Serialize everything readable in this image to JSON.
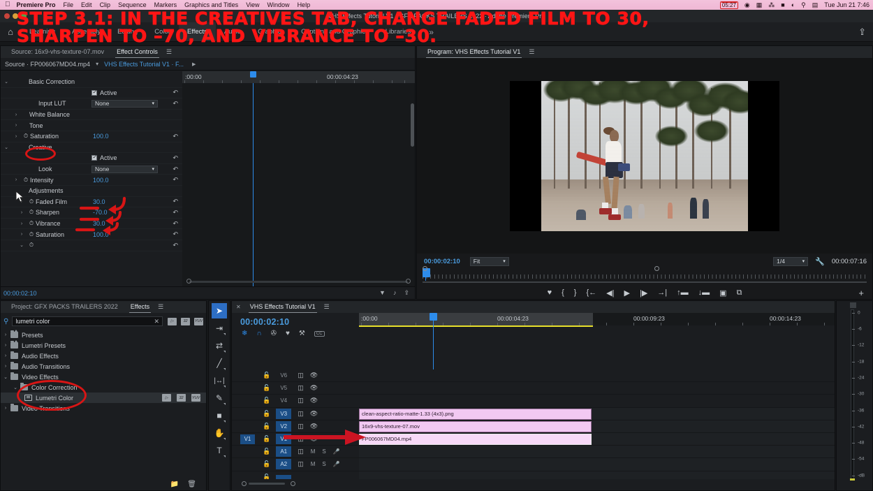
{
  "macmenu": {
    "apple": "",
    "items": [
      "Premiere Pro",
      "File",
      "Edit",
      "Clip",
      "Sequence",
      "Markers",
      "Graphics and Titles",
      "View",
      "Window",
      "Help"
    ],
    "status": {
      "record_time": "05:27",
      "clock": "Tue Jun 21  7:46"
    }
  },
  "titlebar": {
    "title": "VHS Effects Tutorial V1 · GFX PACKS TRAILERS 2022 · Adobe Premiere Pro"
  },
  "workspace": {
    "home_icon": "home-icon",
    "tabs": [
      "Learning",
      "Assembly",
      "Editing",
      "Color",
      "Effects",
      "Audio",
      "Graphics",
      "Captions and Graphics",
      "Libraries"
    ],
    "selected_tab": "Effects",
    "more": "»",
    "export_icon": "export-icon"
  },
  "annotation": {
    "line1": "STEP 3.1: IN THE CREATIVES TAB, CHANGE FADED FILM TO 30,",
    "line2": "SHARPEN TO –70, AND VIBRANCE TO –30.",
    "color": "#ff1515"
  },
  "effect_controls": {
    "tabs": [
      {
        "label": "Source: 16x9-vhs-texture-07.mov",
        "selected": false
      },
      {
        "label": "Effect Controls",
        "selected": true
      }
    ],
    "clip_source": "Source · FP006067MD04.mp4",
    "sequence": "VHS Effects Tutorial V1 · F...",
    "ruler": {
      "left_tc": ":00:00",
      "mid_tc": "00:00:04:23"
    },
    "rows": [
      {
        "type": "group",
        "label": "Basic Correction",
        "indent": 1,
        "arrow": "⌄"
      },
      {
        "type": "check",
        "label": "Active",
        "indent": 2,
        "checked": true
      },
      {
        "type": "dropdown",
        "label": "Input LUT",
        "indent": 2,
        "value": "None"
      },
      {
        "type": "group",
        "label": "White Balance",
        "indent": 2,
        "arrow": "›"
      },
      {
        "type": "group",
        "label": "Tone",
        "indent": 2,
        "arrow": "›"
      },
      {
        "type": "value",
        "label": "Saturation",
        "indent": 2,
        "arrow": "›",
        "value": "100.0",
        "stopwatch": true
      },
      {
        "type": "group",
        "label": "Creative",
        "indent": 1,
        "arrow": "⌄"
      },
      {
        "type": "check",
        "label": "Active",
        "indent": 2,
        "checked": true
      },
      {
        "type": "dropdown",
        "label": "Look",
        "indent": 2,
        "value": "None"
      },
      {
        "type": "value",
        "label": "Intensity",
        "indent": 2,
        "arrow": "›",
        "value": "100.0",
        "stopwatch": true
      },
      {
        "type": "group",
        "label": "Adjustments",
        "indent": 2,
        "arrow": ""
      },
      {
        "type": "value",
        "label": "Faded Film",
        "indent": 3,
        "arrow": "›",
        "value": "30.0",
        "stopwatch": true
      },
      {
        "type": "value",
        "label": "Sharpen",
        "indent": 3,
        "arrow": "›",
        "value": "-70.0",
        "stopwatch": true
      },
      {
        "type": "value",
        "label": "Vibrance",
        "indent": 3,
        "arrow": "›",
        "value": "30.0",
        "stopwatch": true
      },
      {
        "type": "value",
        "label": "Saturation",
        "indent": 3,
        "arrow": "›",
        "value": "100.0",
        "stopwatch": true
      },
      {
        "type": "group",
        "label": "",
        "indent": 3,
        "arrow": "⌄",
        "stopwatch": true
      }
    ],
    "footer_tc": "00:00:02:10"
  },
  "program_monitor": {
    "tab_label": "Program: VHS Effects Tutorial V1",
    "playhead_tc": "00:00:02:10",
    "zoom_level": "Fit",
    "quality": "1/4",
    "duration_tc": "00:00:07:16",
    "transport": [
      {
        "name": "add-marker-button",
        "glyph": "♥"
      },
      {
        "name": "mark-in-button",
        "glyph": "{"
      },
      {
        "name": "mark-out-button",
        "glyph": "}"
      },
      {
        "name": "go-to-in-button",
        "glyph": "{←"
      },
      {
        "name": "step-back-button",
        "glyph": "◀|"
      },
      {
        "name": "play-stop-button",
        "glyph": "▶"
      },
      {
        "name": "step-forward-button",
        "glyph": "|▶"
      },
      {
        "name": "go-to-out-button",
        "glyph": "→|"
      },
      {
        "name": "lift-button",
        "glyph": "↑▬"
      },
      {
        "name": "extract-button",
        "glyph": "↓▬"
      },
      {
        "name": "export-frame-button",
        "glyph": "▣"
      },
      {
        "name": "comparison-view-button",
        "glyph": "⧉"
      }
    ],
    "button_editor": "+"
  },
  "effects_panel": {
    "tabs": [
      {
        "label": "Project: GFX PACKS TRAILERS 2022",
        "selected": false
      },
      {
        "label": "Effects",
        "selected": true
      }
    ],
    "search_value": "lumetri color",
    "badges": [
      "accelerated-effect-badge",
      "32-bit-color-badge",
      "yuv-color-badge"
    ],
    "tree": [
      {
        "label": "Presets",
        "indent": 0,
        "arrow": "›",
        "icon": "preset-folder",
        "selected": false
      },
      {
        "label": "Lumetri Presets",
        "indent": 0,
        "arrow": "›",
        "icon": "preset-folder",
        "selected": false
      },
      {
        "label": "Audio Effects",
        "indent": 0,
        "arrow": "›",
        "icon": "folder",
        "selected": false
      },
      {
        "label": "Audio Transitions",
        "indent": 0,
        "arrow": "›",
        "icon": "folder",
        "selected": false
      },
      {
        "label": "Video Effects",
        "indent": 0,
        "arrow": "⌄",
        "icon": "folder",
        "selected": false
      },
      {
        "label": "Color Correction",
        "indent": 1,
        "arrow": "⌄",
        "icon": "folder",
        "selected": false
      },
      {
        "label": "Lumetri Color",
        "indent": 2,
        "arrow": "",
        "icon": "effect",
        "selected": true
      },
      {
        "label": "Video Transitions",
        "indent": 0,
        "arrow": "›",
        "icon": "folder",
        "selected": false
      }
    ]
  },
  "tools": [
    {
      "name": "selection-tool",
      "glyph": "➤",
      "selected": true
    },
    {
      "name": "track-select-tool",
      "glyph": "⇥",
      "selected": false
    },
    {
      "name": "ripple-edit-tool",
      "glyph": "⇄",
      "selected": false
    },
    {
      "name": "razor-tool",
      "glyph": "╱",
      "selected": false
    },
    {
      "name": "slip-tool",
      "glyph": "|↔|",
      "selected": false
    },
    {
      "name": "pen-tool",
      "glyph": "✎",
      "selected": false
    },
    {
      "name": "rectangle-tool",
      "glyph": "■",
      "selected": false
    },
    {
      "name": "hand-tool",
      "glyph": "✋",
      "selected": false
    },
    {
      "name": "type-tool",
      "glyph": "T",
      "selected": false
    }
  ],
  "timeline": {
    "tab_label": "VHS Effects Tutorial V1",
    "playhead_tc": "00:00:02:10",
    "toolbar": [
      {
        "name": "nest-sequence-icon",
        "glyph": "❄"
      },
      {
        "name": "snap-icon",
        "glyph": "∩"
      },
      {
        "name": "linked-selection-icon",
        "glyph": "✇"
      },
      {
        "name": "add-marker-icon",
        "glyph": "♥"
      },
      {
        "name": "timeline-settings-icon",
        "glyph": "⚒"
      },
      {
        "name": "captions-icon",
        "glyph": "CC"
      }
    ],
    "ruler_labels": [
      ":00:00",
      "00:00:04:23",
      "00:00:09:23",
      "00:00:14:23"
    ],
    "tracks": [
      {
        "name": "V6",
        "type": "video",
        "active": false,
        "clip": null
      },
      {
        "name": "V5",
        "type": "video",
        "active": false,
        "clip": null
      },
      {
        "name": "V4",
        "type": "video",
        "active": false,
        "clip": null
      },
      {
        "name": "V3",
        "type": "video",
        "active": true,
        "clip": "clean-aspect-ratio-matte-1.33 (4x3).png",
        "selected": false
      },
      {
        "name": "V2",
        "type": "video",
        "active": true,
        "clip": "16x9-vhs-texture-07.mov",
        "selected": false
      },
      {
        "name": "V1",
        "type": "video",
        "active": true,
        "clip": "FP006067MD04.mp4",
        "selected": true
      },
      {
        "name": "A1",
        "type": "audio",
        "active": true,
        "clip": null,
        "mute": "M",
        "solo": "S"
      },
      {
        "name": "A2",
        "type": "audio",
        "active": true,
        "clip": null,
        "mute": "M",
        "solo": "S"
      }
    ],
    "source_target_v1": "V1"
  },
  "audio_meter": {
    "labels": [
      "0",
      "-6",
      "-12",
      "-18",
      "-24",
      "-30",
      "-36",
      "-42",
      "-48",
      "-54",
      "-dB"
    ]
  }
}
